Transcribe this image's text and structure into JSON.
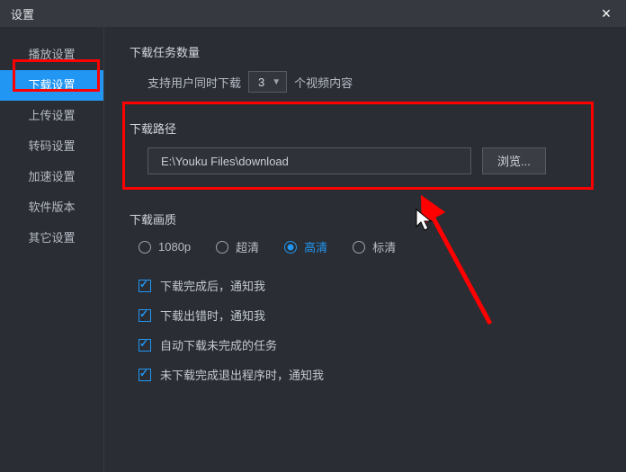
{
  "titlebar": {
    "title": "设置"
  },
  "sidebar": {
    "items": [
      {
        "label": "播放设置"
      },
      {
        "label": "下载设置"
      },
      {
        "label": "上传设置"
      },
      {
        "label": "转码设置"
      },
      {
        "label": "加速设置"
      },
      {
        "label": "软件版本"
      },
      {
        "label": "其它设置"
      }
    ]
  },
  "tasks": {
    "title": "下载任务数量",
    "prefix": "支持用户同时下载",
    "value": "3",
    "suffix": "个视频内容"
  },
  "path": {
    "title": "下载路径",
    "value": "E:\\Youku Files\\download",
    "browse": "浏览..."
  },
  "quality": {
    "title": "下载画质",
    "options": [
      {
        "label": "1080p"
      },
      {
        "label": "超清"
      },
      {
        "label": "高清"
      },
      {
        "label": "标清"
      }
    ]
  },
  "checks": [
    {
      "label": "下载完成后，通知我"
    },
    {
      "label": "下载出错时，通知我"
    },
    {
      "label": "自动下载未完成的任务"
    },
    {
      "label": "未下载完成退出程序时，通知我"
    }
  ]
}
